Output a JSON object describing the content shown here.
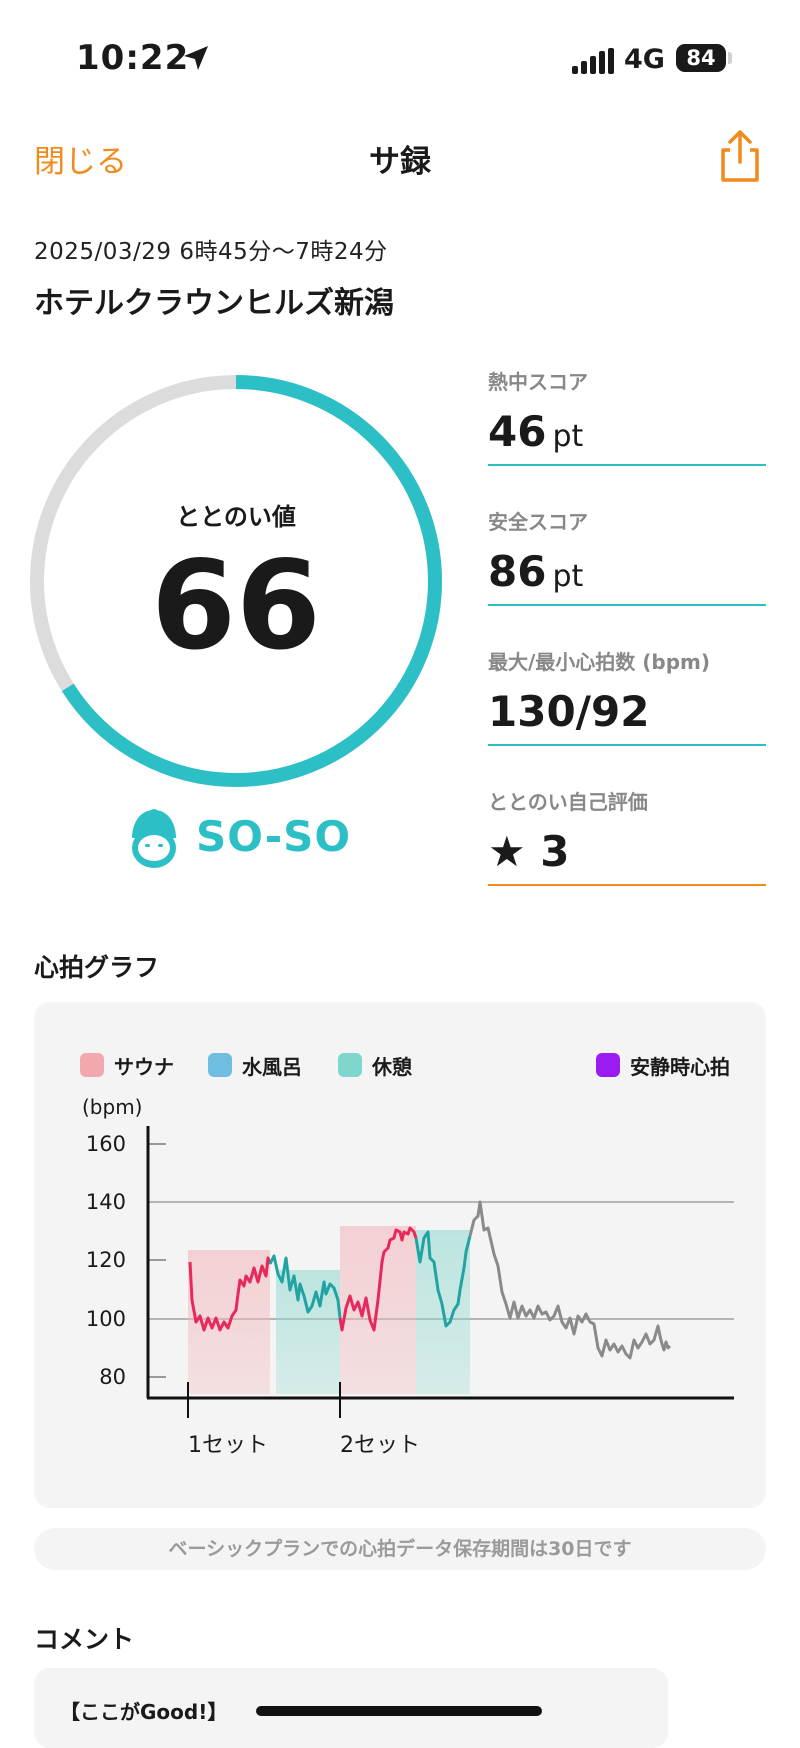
{
  "status_bar": {
    "time": "10:22",
    "network": "4G",
    "battery": "84"
  },
  "nav": {
    "close": "閉じる",
    "title": "サ録"
  },
  "header": {
    "date": "2025/03/29 6時45分〜7時24分",
    "facility": "ホテルクラウンヒルズ新潟"
  },
  "gauge": {
    "label": "ととのい値",
    "value": "66",
    "rating": "SO-SO",
    "progress": 0.66
  },
  "stats": [
    {
      "label": "熱中スコア",
      "value": "46",
      "unit": "pt"
    },
    {
      "label": "安全スコア",
      "value": "86",
      "unit": "pt"
    },
    {
      "label": "最大/最小心拍数 (bpm)",
      "value": "130/92",
      "unit": ""
    },
    {
      "label": "ととのい自己評価",
      "value": "★ 3",
      "unit": ""
    }
  ],
  "graph": {
    "section_title": "心拍グラフ",
    "legend": [
      {
        "label": "サウナ",
        "color": "#f2a8ae"
      },
      {
        "label": "水風呂",
        "color": "#6fbde0"
      },
      {
        "label": "休憩",
        "color": "#7ed6cc"
      },
      {
        "label": "安静時心拍",
        "color": "#9b1cf0"
      }
    ],
    "y_unit": "(bpm)",
    "y_ticks": [
      "160",
      "140",
      "120",
      "100",
      "80"
    ],
    "x_markers": [
      "1セット",
      "2セット"
    ]
  },
  "note": "ベーシックプランでの心拍データ保存期間は30日です",
  "comment": {
    "section_title": "コメント",
    "first_line": "【ここがGood!】"
  }
}
